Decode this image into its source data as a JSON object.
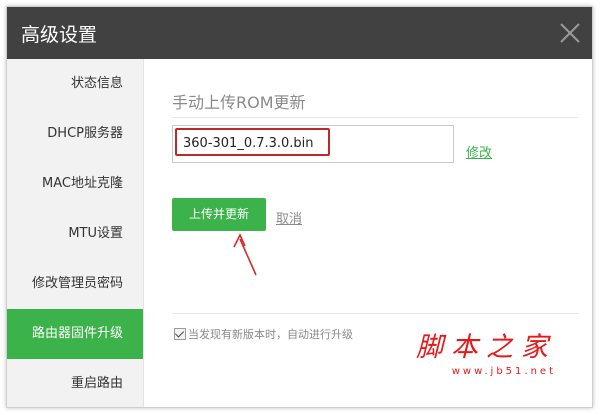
{
  "dialog": {
    "title": "高级设置"
  },
  "sidebar": {
    "items": [
      {
        "label": "状态信息"
      },
      {
        "label": "DHCP服务器"
      },
      {
        "label": "MAC地址克隆"
      },
      {
        "label": "MTU设置"
      },
      {
        "label": "修改管理员密码"
      },
      {
        "label": "路由器固件升级",
        "active": true
      },
      {
        "label": "重启路由"
      }
    ]
  },
  "main": {
    "section_title": "手动上传ROM更新",
    "file_value": "360-301_0.7.3.0.bin",
    "modify_label": "修改",
    "upload_label": "上传并更新",
    "cancel_label": "取消",
    "auto_upgrade_label": "当发现有新版本时，自动进行升级",
    "auto_upgrade_checked": true
  },
  "watermark": {
    "big": "脚本之家",
    "small": "www.jb51.net"
  },
  "colors": {
    "accent": "#3bb34a",
    "titlebar": "#414141",
    "highlight_border": "#c0272d"
  }
}
